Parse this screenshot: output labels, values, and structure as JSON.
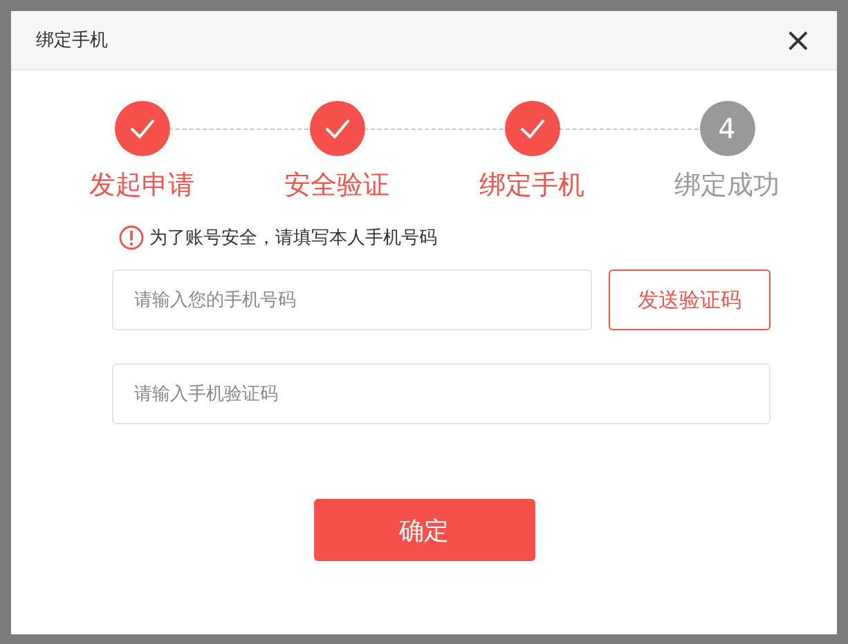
{
  "dialog": {
    "title": "绑定手机",
    "close": "×"
  },
  "steps": [
    {
      "label": "发起申请",
      "done": true
    },
    {
      "label": "安全验证",
      "done": true
    },
    {
      "label": "绑定手机",
      "done": true
    },
    {
      "label": "绑定成功",
      "done": false,
      "number": "4"
    }
  ],
  "notice": "为了账号安全，请填写本人手机号码",
  "phone_field": {
    "placeholder": "请输入您的手机号码"
  },
  "send_code_button": "发送验证码",
  "code_field": {
    "placeholder": "请输入手机验证码"
  },
  "confirm_button": "确定"
}
